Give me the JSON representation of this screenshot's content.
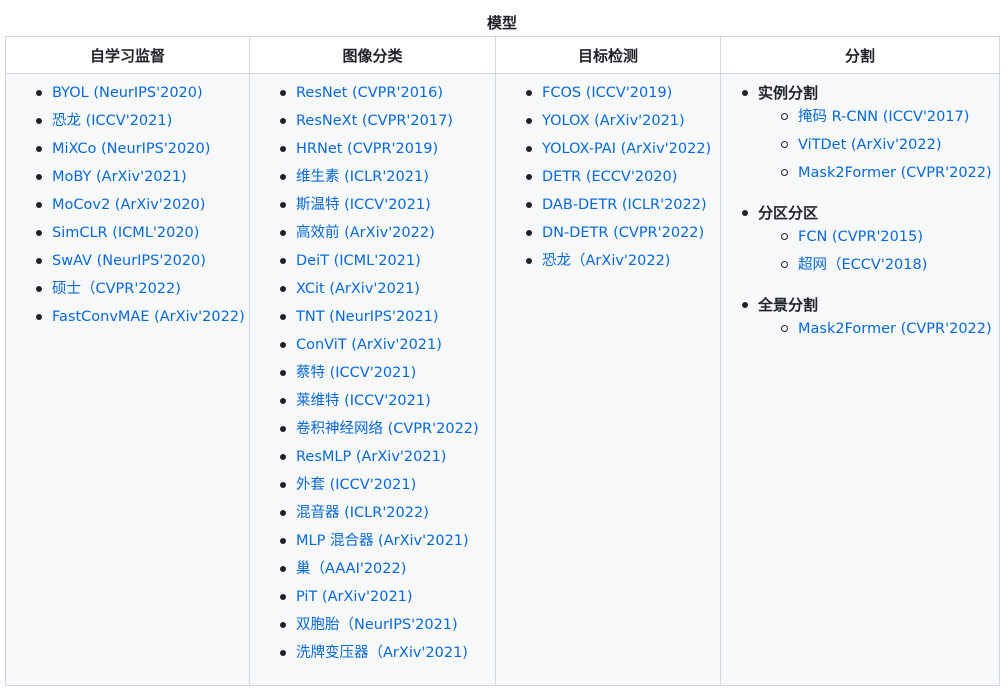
{
  "caption": "模型",
  "colors": {
    "link": "#0969da",
    "text": "#1f2328",
    "border": "#d0d7de",
    "cell_background": "#f6f8fa"
  },
  "columns": [
    {
      "header": "自学习监督",
      "items": [
        "BYOL (NeurIPS'2020)",
        "恐龙 (ICCV'2021)",
        "MiXCo (NeurIPS'2020)",
        "MoBY (ArXiv'2021)",
        "MoCov2 (ArXiv'2020)",
        "SimCLR (ICML'2020)",
        "SwAV (NeurIPS'2020)",
        "硕士（CVPR'2022)",
        "FastConvMAE (ArXiv'2022)"
      ]
    },
    {
      "header": "图像分类",
      "items": [
        "ResNet (CVPR'2016)",
        "ResNeXt (CVPR'2017)",
        "HRNet (CVPR'2019)",
        "维生素 (ICLR'2021)",
        "斯温特 (ICCV'2021)",
        "高效前 (ArXiv'2022)",
        "DeiT (ICML'2021)",
        "XCit (ArXiv'2021)",
        "TNT (NeurIPS'2021)",
        "ConViT (ArXiv'2021)",
        "蔡特 (ICCV'2021)",
        "莱维特 (ICCV'2021)",
        "卷积神经网络 (CVPR'2022)",
        "ResMLP (ArXiv'2021)",
        "外套 (ICCV'2021)",
        "混音器 (ICLR'2022)",
        "MLP 混合器 (ArXiv'2021)",
        "巢（AAAI'2022)",
        "PiT (ArXiv'2021)",
        "双胞胎（NeurIPS'2021)",
        "洗牌变压器（ArXiv'2021)"
      ]
    },
    {
      "header": "目标检测",
      "items": [
        "FCOS (ICCV'2019)",
        "YOLOX (ArXiv'2021)",
        "YOLOX-PAI (ArXiv'2022)",
        "DETR (ECCV'2020)",
        "DAB-DETR (ICLR'2022)",
        "DN-DETR (CVPR'2022)",
        "恐龙（ArXiv'2022)"
      ]
    },
    {
      "header": "分割",
      "groups": [
        {
          "title": "实例分割",
          "items": [
            "掩码 R-CNN (ICCV'2017)",
            "ViTDet (ArXiv'2022)",
            "Mask2Former (CVPR'2022)"
          ]
        },
        {
          "title": "分区分区",
          "items": [
            "FCN (CVPR'2015)",
            "超网（ECCV'2018)"
          ]
        },
        {
          "title": "全景分割",
          "items": [
            "Mask2Former (CVPR'2022)"
          ]
        }
      ]
    }
  ]
}
